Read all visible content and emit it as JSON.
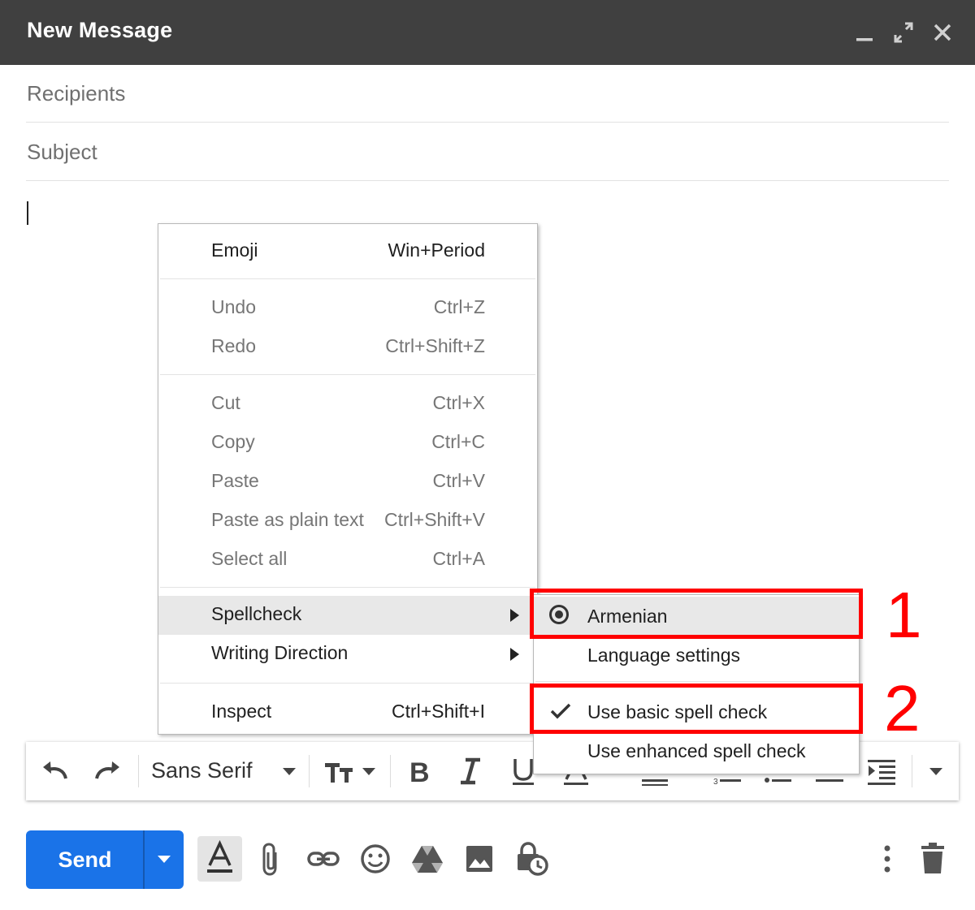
{
  "window": {
    "title": "New Message",
    "controls": [
      "minimize-icon",
      "fullscreen-icon",
      "close-icon"
    ]
  },
  "fields": {
    "recipients_placeholder": "Recipients",
    "subject_placeholder": "Subject"
  },
  "context_menu": {
    "emoji": {
      "label": "Emoji",
      "shortcut": "Win+Period"
    },
    "undo": {
      "label": "Undo",
      "shortcut": "Ctrl+Z"
    },
    "redo": {
      "label": "Redo",
      "shortcut": "Ctrl+Shift+Z"
    },
    "cut": {
      "label": "Cut",
      "shortcut": "Ctrl+X"
    },
    "copy": {
      "label": "Copy",
      "shortcut": "Ctrl+C"
    },
    "paste": {
      "label": "Paste",
      "shortcut": "Ctrl+V"
    },
    "paste_plain": {
      "label": "Paste as plain text",
      "shortcut": "Ctrl+Shift+V"
    },
    "select_all": {
      "label": "Select all",
      "shortcut": "Ctrl+A"
    },
    "spellcheck": {
      "label": "Spellcheck"
    },
    "writing_direction": {
      "label": "Writing Direction"
    },
    "inspect": {
      "label": "Inspect",
      "shortcut": "Ctrl+Shift+I"
    }
  },
  "spellcheck_submenu": {
    "armenian": "Armenian",
    "language_settings": "Language settings",
    "basic_spell_check": "Use basic spell check",
    "enhanced_spell_check": "Use enhanced spell check"
  },
  "annotations": {
    "one": "1",
    "two": "2",
    "color": "#ff0000"
  },
  "toolbar": {
    "font_name": "Sans Serif"
  },
  "actions": {
    "send_label": "Send"
  },
  "colors": {
    "header_bg": "#404040",
    "send_blue": "#1a73e8",
    "menu_hover": "#e8e8e8"
  }
}
